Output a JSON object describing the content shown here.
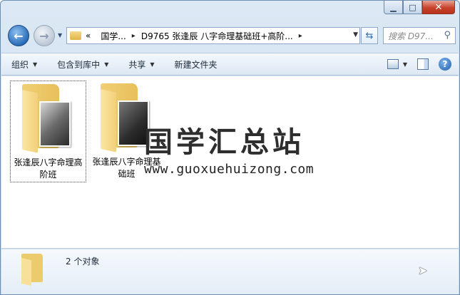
{
  "window": {
    "minimize_label": "▁",
    "maximize_label": "□",
    "close_label": "✕"
  },
  "nav": {
    "back_icon": "back-arrow-icon",
    "forward_icon": "forward-arrow-icon",
    "breadcrumb": {
      "overflow": "«",
      "items": [
        "国学...",
        "D9765 张逢辰 八字命理基础班+高阶..."
      ],
      "separator": "▸"
    },
    "search": {
      "placeholder": "搜索 D97..."
    }
  },
  "toolbar": {
    "organize_label": "组织",
    "include_label": "包含到库中",
    "share_label": "共享",
    "new_folder_label": "新建文件夹",
    "help_label": "?"
  },
  "files": [
    {
      "name": "张逢辰八字命理高阶班",
      "selected": true
    },
    {
      "name": "张逢辰八字命理基础班",
      "selected": false
    }
  ],
  "watermark": {
    "title": "国学汇总站",
    "url": "www.guoxuehuizong.com"
  },
  "details": {
    "count_text": "2 个对象"
  }
}
